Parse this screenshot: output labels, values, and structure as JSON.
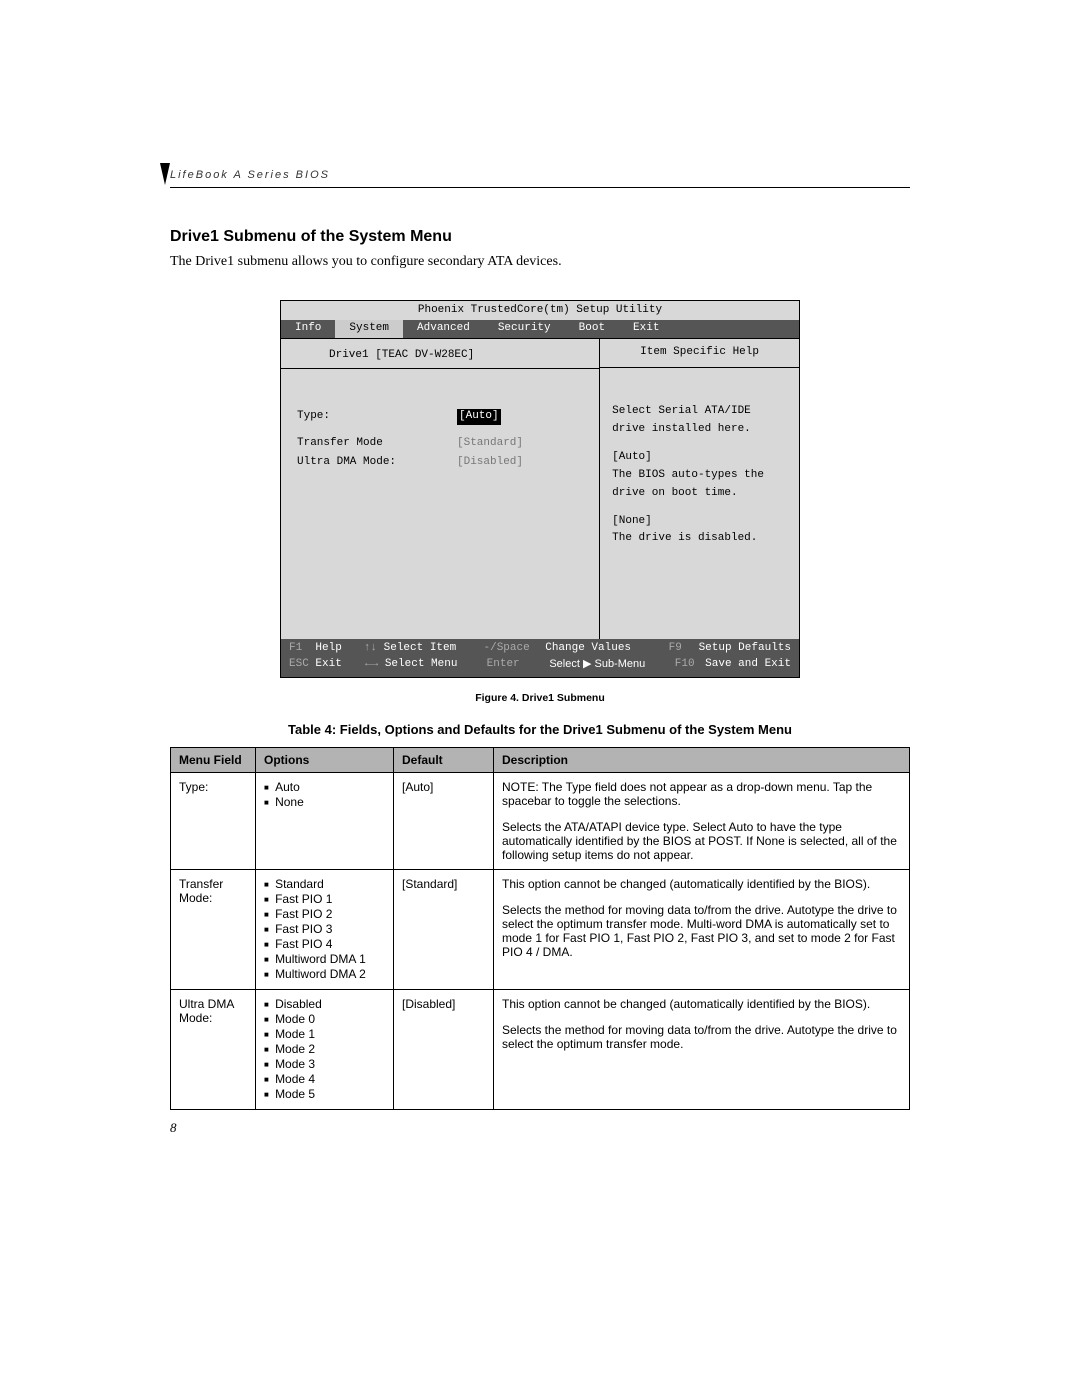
{
  "header": "LifeBook A Series BIOS",
  "sectionTitle": "Drive1 Submenu of the System Menu",
  "intro": "The Drive1 submenu allows you to configure secondary ATA devices.",
  "bios": {
    "windowTitle": "Phoenix TrustedCore(tm) Setup Utility",
    "tabs": [
      "Info",
      "System",
      "Advanced",
      "Security",
      "Boot",
      "Exit"
    ],
    "activeTab": "System",
    "driveHeader": "Drive1 [TEAC    DV-W28EC]",
    "fields": [
      {
        "label": "Type:",
        "value": "[Auto]",
        "style": "highlight"
      },
      {
        "label": "Transfer Mode",
        "value": "[Standard]",
        "style": "dim"
      },
      {
        "label": "Ultra DMA Mode:",
        "value": "[Disabled]",
        "style": "dim"
      }
    ],
    "help": {
      "title": "Item Specific Help",
      "lines": [
        "Select Serial ATA/IDE",
        "drive installed here.",
        "",
        "[Auto]",
        "The BIOS auto-types the",
        "drive on boot time.",
        "",
        "[None]",
        "The drive is disabled."
      ]
    },
    "footer": {
      "r1": {
        "k1": "F1",
        "a1": "Help",
        "k2": "↑↓",
        "a2": "Select Item",
        "k3": "-/Space",
        "a3": "Change Values",
        "k4": "F9",
        "a4": "Setup Defaults"
      },
      "r2": {
        "k1": "ESC",
        "a1": "Exit",
        "k2": "←→",
        "a2": "Select Menu",
        "k3": "Enter",
        "a3": "Select ▶ Sub-Menu",
        "k4": "F10",
        "a4": "Save and Exit"
      }
    }
  },
  "figureCaption": "Figure 4.  Drive1 Submenu",
  "tableCaption": "Table 4: Fields, Options and Defaults for the Drive1 Submenu of the System Menu",
  "table": {
    "headers": {
      "c1": "Menu Field",
      "c2": "Options",
      "c3": "Default",
      "c4": "Description"
    },
    "rows": [
      {
        "field": "Type:",
        "options": [
          "Auto",
          "None"
        ],
        "def": "[Auto]",
        "desc": [
          "NOTE: The Type field does not appear as a drop-down menu. Tap the spacebar to toggle the selections.",
          "Selects the ATA/ATAPI device type. Select Auto to have the type automatically identified by the BIOS at POST. If None is selected, all of the following setup items do not appear."
        ]
      },
      {
        "field": "Transfer Mode:",
        "options": [
          "Standard",
          "Fast PIO 1",
          "Fast PIO 2",
          "Fast PIO 3",
          "Fast PIO 4",
          "Multiword DMA 1",
          "Multiword DMA 2"
        ],
        "def": "[Standard]",
        "desc": [
          "This option cannot be changed (automatically identified by the BIOS).",
          "Selects the method for moving data to/from the drive. Autotype the drive to select the optimum transfer mode.  Multi-word DMA is automatically set to mode 1 for Fast PIO 1, Fast PIO 2, Fast PIO 3, and set to mode 2 for Fast PIO 4 / DMA."
        ]
      },
      {
        "field": "Ultra DMA Mode:",
        "options": [
          "Disabled",
          "Mode 0",
          "Mode 1",
          "Mode 2",
          "Mode 3",
          "Mode 4",
          "Mode 5"
        ],
        "def": "[Disabled]",
        "desc": [
          "This option cannot be changed (automatically identified by the BIOS).",
          "Selects the method for moving data to/from the drive. Autotype the drive to select the optimum transfer mode."
        ]
      }
    ]
  },
  "pageNumber": "8"
}
